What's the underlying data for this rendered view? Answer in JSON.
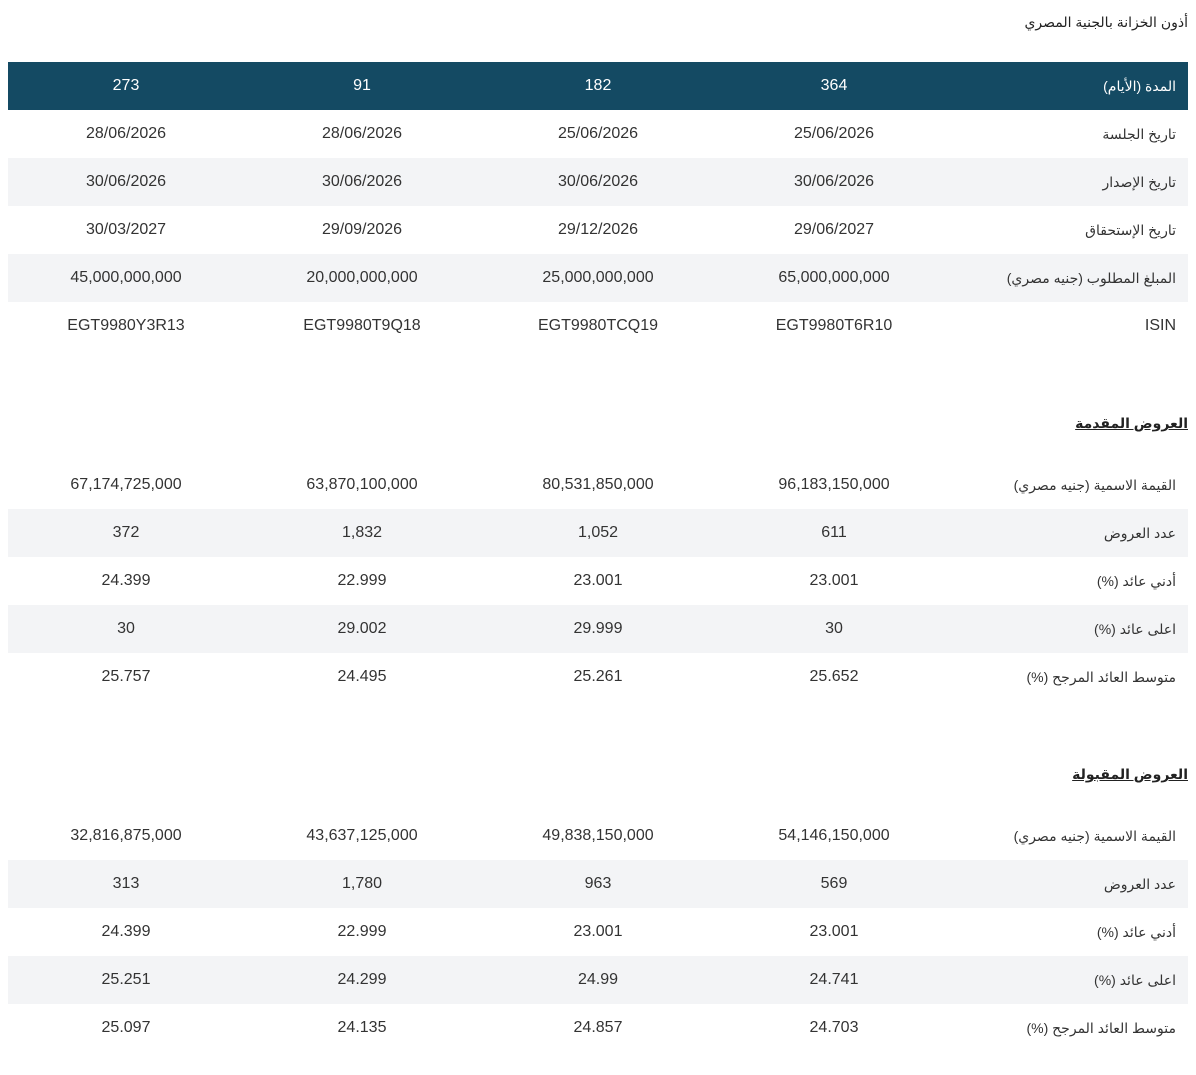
{
  "page_title": "أذون الخزانة بالجنية المصري",
  "main_table": {
    "header": {
      "label": "المدة (الأيام)",
      "values": [
        "364",
        "182",
        "91",
        "273"
      ]
    },
    "rows": [
      {
        "label": "تاريخ الجلسة",
        "values": [
          "25/06/2026",
          "25/06/2026",
          "28/06/2026",
          "28/06/2026"
        ]
      },
      {
        "label": "تاريخ الإصدار",
        "values": [
          "30/06/2026",
          "30/06/2026",
          "30/06/2026",
          "30/06/2026"
        ]
      },
      {
        "label": "تاريخ الإستحقاق",
        "values": [
          "29/06/2027",
          "29/12/2026",
          "29/09/2026",
          "30/03/2027"
        ]
      },
      {
        "label": "المبلغ المطلوب (جنيه مصري)",
        "values": [
          "65,000,000,000",
          "25,000,000,000",
          "20,000,000,000",
          "45,000,000,000"
        ]
      },
      {
        "label": "ISIN",
        "values": [
          "EGT9980T6R10",
          "EGT9980TCQ19",
          "EGT9980T9Q18",
          "EGT9980Y3R13"
        ]
      }
    ]
  },
  "offered": {
    "title": "العروض المقدمة",
    "rows": [
      {
        "label": "القيمة الاسمية (جنيه مصري)",
        "values": [
          "96,183,150,000",
          "80,531,850,000",
          "63,870,100,000",
          "67,174,725,000"
        ]
      },
      {
        "label": "عدد العروض",
        "values": [
          "611",
          "1,052",
          "1,832",
          "372"
        ]
      },
      {
        "label": "أدني عائد (%)",
        "values": [
          "23.001",
          "23.001",
          "22.999",
          "24.399"
        ]
      },
      {
        "label": "اعلى عائد (%)",
        "values": [
          "30",
          "29.999",
          "29.002",
          "30"
        ]
      },
      {
        "label": "متوسط العائد المرجح (%)",
        "values": [
          "25.652",
          "25.261",
          "24.495",
          "25.757"
        ]
      }
    ]
  },
  "accepted": {
    "title": "العروض المقبولة",
    "rows": [
      {
        "label": "القيمة الاسمية (جنيه مصري)",
        "values": [
          "54,146,150,000",
          "49,838,150,000",
          "43,637,125,000",
          "32,816,875,000"
        ]
      },
      {
        "label": "عدد العروض",
        "values": [
          "569",
          "963",
          "1,780",
          "313"
        ]
      },
      {
        "label": "أدني عائد (%)",
        "values": [
          "23.001",
          "23.001",
          "22.999",
          "24.399"
        ]
      },
      {
        "label": "اعلى عائد (%)",
        "values": [
          "24.741",
          "24.99",
          "24.299",
          "25.251"
        ]
      },
      {
        "label": "متوسط العائد المرجح (%)",
        "values": [
          "24.703",
          "24.857",
          "24.135",
          "25.097"
        ]
      }
    ]
  },
  "colors": {
    "header_bg": "#144a63",
    "header_text": "#ffffff",
    "alt_row_bg": "#f3f4f6"
  }
}
